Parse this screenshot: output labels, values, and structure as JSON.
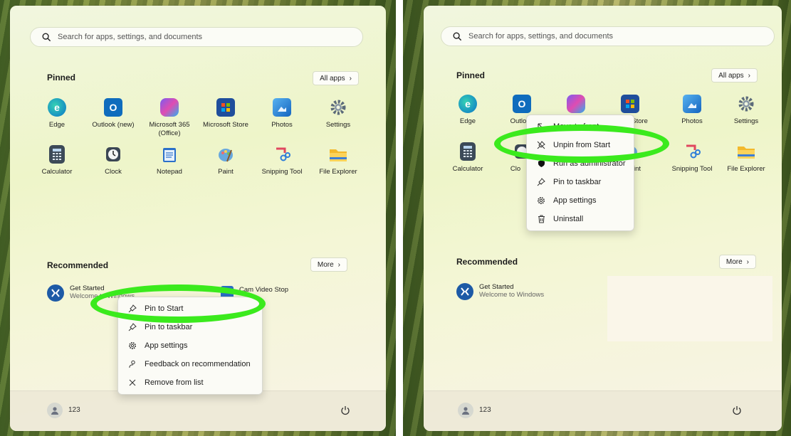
{
  "left_panel": {
    "search": {
      "placeholder": "Search for apps, settings, and documents"
    },
    "pinned": {
      "title": "Pinned",
      "all_apps": "All apps",
      "apps": [
        {
          "label": "Edge",
          "icon": "edge-icon"
        },
        {
          "label": "Outlook (new)",
          "icon": "outlook-icon"
        },
        {
          "label": "Microsoft 365 (Office)",
          "icon": "microsoft-365-icon"
        },
        {
          "label": "Microsoft Store",
          "icon": "store-icon"
        },
        {
          "label": "Photos",
          "icon": "photos-icon"
        },
        {
          "label": "Settings",
          "icon": "gear-icon"
        },
        {
          "label": "Calculator",
          "icon": "calculator-icon"
        },
        {
          "label": "Clock",
          "icon": "clock-icon"
        },
        {
          "label": "Notepad",
          "icon": "notepad-icon"
        },
        {
          "label": "Paint",
          "icon": "paint-icon"
        },
        {
          "label": "Snipping Tool",
          "icon": "snipping-tool-icon"
        },
        {
          "label": "File Explorer",
          "icon": "folder-icon"
        }
      ]
    },
    "recommended": {
      "title": "Recommended",
      "more": "More",
      "items": [
        {
          "title": "Get Started",
          "subtitle": "Welcome to Windows"
        },
        {
          "title": "Cam Video Stop",
          "subtitle": "..."
        }
      ]
    },
    "context_menu": {
      "items": [
        {
          "label": "Pin to Start",
          "icon": "pin-icon"
        },
        {
          "label": "Pin to taskbar",
          "icon": "pin-icon"
        },
        {
          "label": "App settings",
          "icon": "gear-icon"
        },
        {
          "label": "Feedback on recommendation",
          "icon": "feedback-icon"
        },
        {
          "label": "Remove from list",
          "icon": "close-icon"
        }
      ]
    },
    "user": {
      "name": "123"
    }
  },
  "right_panel": {
    "search": {
      "placeholder": "Search for apps, settings, and documents"
    },
    "pinned": {
      "title": "Pinned",
      "all_apps": "All apps",
      "apps": [
        {
          "label": "Edge",
          "icon": "edge-icon"
        },
        {
          "label": "Outlook",
          "icon": "outlook-icon"
        },
        {
          "label": "",
          "icon": "microsoft-365-icon"
        },
        {
          "label": "oft Store",
          "icon": "store-icon"
        },
        {
          "label": "Photos",
          "icon": "photos-icon"
        },
        {
          "label": "Settings",
          "icon": "gear-icon"
        },
        {
          "label": "Calculator",
          "icon": "calculator-icon"
        },
        {
          "label": "Clo",
          "icon": "clock-icon"
        },
        {
          "label": "int",
          "icon": "paint-icon"
        },
        {
          "label": "Snipping Tool",
          "icon": "snipping-tool-icon"
        },
        {
          "label": "File Explorer",
          "icon": "folder-icon"
        }
      ]
    },
    "recommended": {
      "title": "Recommended",
      "more": "More",
      "items": [
        {
          "title": "Get Started",
          "subtitle": "Welcome to Windows"
        }
      ]
    },
    "context_menu": {
      "items": [
        {
          "label": "Move to front",
          "icon": "move-to-front-icon"
        },
        {
          "label": "Unpin from Start",
          "icon": "unpin-icon"
        },
        {
          "label": "Run as administrator",
          "icon": "shield-icon"
        },
        {
          "label": "Pin to taskbar",
          "icon": "pin-icon"
        },
        {
          "label": "App settings",
          "icon": "gear-icon"
        },
        {
          "label": "Uninstall",
          "icon": "trash-icon"
        }
      ]
    },
    "user": {
      "name": "123"
    }
  },
  "colors": {
    "highlight_ring": "#3bea1d",
    "accent": "#0078d4"
  }
}
